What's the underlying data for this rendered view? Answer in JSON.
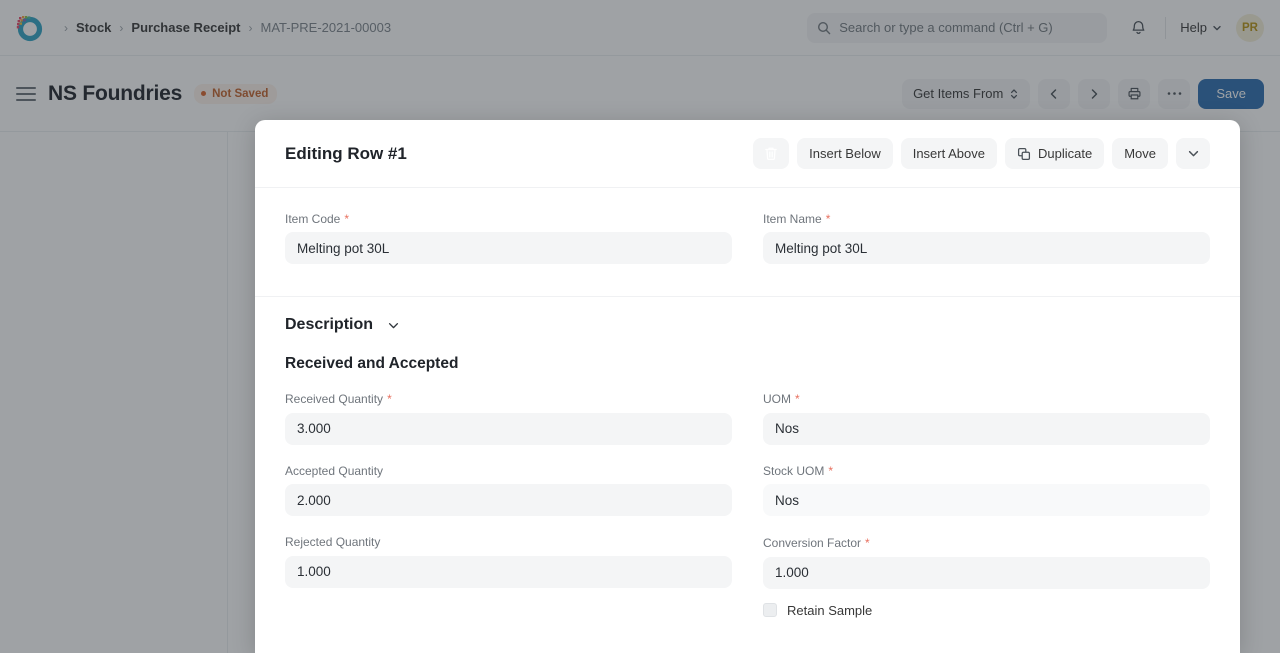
{
  "navbar": {
    "logo_icon": "frappe-logo-icon",
    "breadcrumb": {
      "separator": "›",
      "items": [
        {
          "label": "Stock",
          "current": false
        },
        {
          "label": "Purchase Receipt",
          "current": false
        },
        {
          "label": "MAT-PRE-2021-00003",
          "current": true
        }
      ]
    },
    "search": {
      "placeholder": "Search or type a command (Ctrl + G)",
      "value": "",
      "icon": "search-icon"
    },
    "notifications_icon": "bell-icon",
    "help_label": "Help",
    "help_chevron_icon": "chevron-down-icon",
    "avatar_initials": "PR"
  },
  "page_head": {
    "menu_icon": "hamburger-menu-icon",
    "title": "NS Foundries",
    "status_badge": "Not Saved",
    "actions": {
      "get_items_from": "Get Items From",
      "prev_icon": "chevron-left-icon",
      "next_icon": "chevron-right-icon",
      "print_icon": "printer-icon",
      "more_icon": "ellipsis-icon",
      "save_label": "Save"
    }
  },
  "modal": {
    "title": "Editing Row #1",
    "actions": {
      "delete_icon": "trash-icon",
      "insert_below": "Insert Below",
      "insert_above": "Insert Above",
      "duplicate": "Duplicate",
      "duplicate_icon": "copy-icon",
      "move": "Move",
      "expand_icon": "chevron-down-icon"
    },
    "fields": {
      "item_code": {
        "label": "Item Code",
        "required": true,
        "value": "Melting pot 30L"
      },
      "item_name": {
        "label": "Item Name",
        "required": true,
        "value": "Melting pot 30L"
      },
      "received_quantity": {
        "label": "Received Quantity",
        "required": true,
        "value": "3.000"
      },
      "uom": {
        "label": "UOM",
        "required": true,
        "value": "Nos"
      },
      "accepted_quantity": {
        "label": "Accepted Quantity",
        "required": false,
        "value": "2.000"
      },
      "stock_uom": {
        "label": "Stock UOM",
        "required": true,
        "value": "Nos"
      },
      "rejected_quantity": {
        "label": "Rejected Quantity",
        "required": false,
        "value": "1.000"
      },
      "conversion_factor": {
        "label": "Conversion Factor",
        "required": true,
        "value": "1.000"
      }
    },
    "sections": {
      "description": {
        "title": "Description",
        "collapsed": true,
        "chevron_icon": "chevron-down-icon"
      },
      "received_and_accepted": {
        "title": "Received and Accepted"
      }
    },
    "retain_sample": {
      "label": "Retain Sample",
      "checked": false
    }
  },
  "colors": {
    "primary": "#2b6caf",
    "danger": "#f06b60",
    "warning_text": "#c4612a",
    "warning_bg": "#fdf3eb",
    "field_bg": "#f4f5f6",
    "required_star": "#e8705f",
    "avatar_bg": "#f5eed8",
    "avatar_text": "#b79212"
  }
}
